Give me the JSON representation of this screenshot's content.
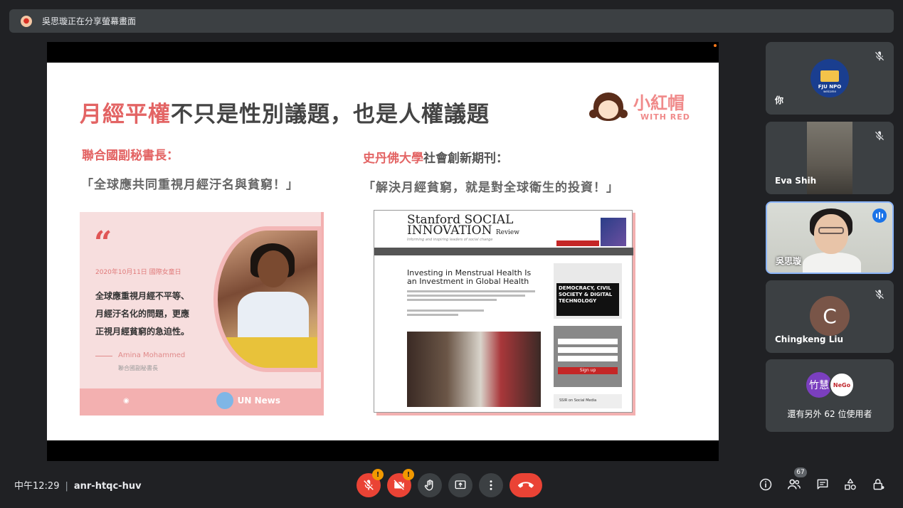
{
  "banner": {
    "text": "吳思璇正在分享螢幕畫面",
    "avatar_icon": "presenter-avatar-icon"
  },
  "slide": {
    "title_highlight": "月經平權",
    "title_rest": "不只是性別議題，也是人權議題",
    "logo_cn": "小紅帽",
    "logo_en": "WITH RED",
    "left_heading": "聯合國副秘書長：",
    "left_quote": "「全球應共同重視月經汙名與貧窮！」",
    "right_heading_highlight": "史丹佛大學",
    "right_heading_rest": "社會創新期刊：",
    "right_quote": "「解決月經貧窮，就是對全球衛生的投資！」",
    "card": {
      "quote_mark": "“",
      "date": "2020年10月11日 國際女童日",
      "body_line1": "全球應重視月經不平等、",
      "body_line2": "月經汙名化的問題，更應",
      "body_line3": "正視月經貧窮的急迫性。",
      "signature": "Amina Mohammed",
      "signature_title": "聯合國副秘書長",
      "footer_un": "UN News"
    },
    "ssir": {
      "masthead_line1": "Stanford SOCIAL",
      "masthead_line2": "INNOVATION",
      "masthead_suffix": "Review",
      "tagline": "Informing and inspiring leaders of social change",
      "article_title": "Investing in Menstrual Health Is an Investment in Global Health",
      "side_ad": "DEMOCRACY, CIVIL SOCIETY & DIGITAL TECHNOLOGY",
      "side_button": "Sign up",
      "side_footer": "SSIR on Social Media"
    }
  },
  "participants": [
    {
      "name": "你",
      "avatar": "FJU NPO",
      "avatar_sub": "welcome",
      "muted": true
    },
    {
      "name": "Eva Shih",
      "muted": true
    },
    {
      "name": "吳思璇",
      "speaking": true
    },
    {
      "name": "Chingkeng Liu",
      "initial": "C",
      "muted": true
    }
  ],
  "others": {
    "avatar1": "竹慧",
    "avatar2": "NeGo",
    "label": "還有另外 62 位使用者"
  },
  "bottom": {
    "time": "中午12:29",
    "separator": "|",
    "meeting_code": "anr-htqc-huv",
    "people_count": "67",
    "warn_mark": "!"
  },
  "colors": {
    "accent_red": "#ea4335",
    "speaking_blue": "#1a73e8",
    "slide_highlight": "#e36464"
  }
}
